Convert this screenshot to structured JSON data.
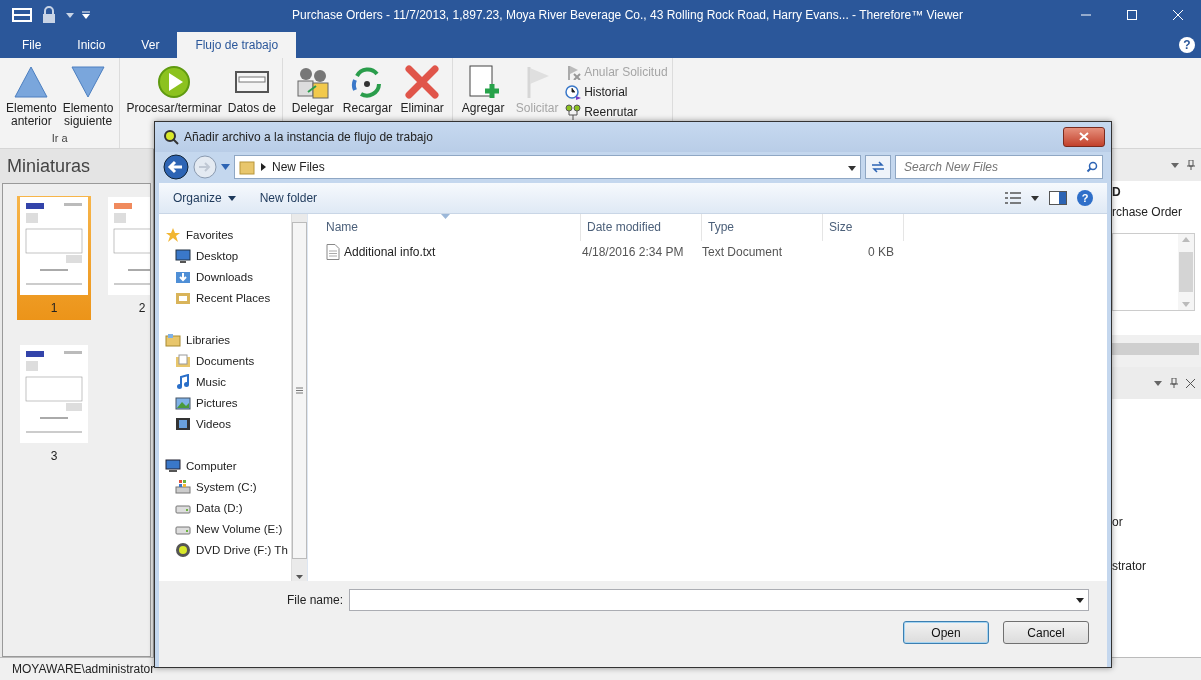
{
  "window": {
    "title": "Purchase Orders - 11/7/2013, 1,897.23, Moya River Beverage Co., 43 Rolling Rock Road, Harry Evans... - Therefore™ Viewer",
    "help": "?"
  },
  "menu_tabs": [
    {
      "label": "File",
      "selected": false
    },
    {
      "label": "Inicio",
      "selected": false
    },
    {
      "label": "Ver",
      "selected": false
    },
    {
      "label": "Flujo de trabajo",
      "selected": true
    }
  ],
  "ribbon": [
    {
      "label": "Ir a",
      "items": [
        {
          "kind": "large",
          "label": "Elemento\nanterior",
          "disabled": false
        },
        {
          "kind": "large",
          "label": "Elemento\nsiguiente",
          "disabled": false
        }
      ]
    },
    {
      "items": [
        {
          "kind": "large",
          "label": "Procesar/terminar",
          "disabled": false
        },
        {
          "kind": "large",
          "label": "Datos de",
          "disabled": false
        }
      ]
    },
    {
      "items": [
        {
          "kind": "large",
          "label": "Delegar",
          "disabled": false
        },
        {
          "kind": "large",
          "label": "Recargar",
          "disabled": false
        },
        {
          "kind": "large",
          "label": "Eliminar",
          "disabled": false
        }
      ]
    },
    {
      "items": [
        {
          "kind": "large",
          "label": "Agregar",
          "disabled": false
        },
        {
          "kind": "large",
          "label": "Solicitar",
          "disabled": true
        },
        {
          "kind": "small",
          "label": "Anular Solicitud",
          "disabled": true
        },
        {
          "kind": "small",
          "label": "Historial",
          "disabled": false
        },
        {
          "kind": "small",
          "label": "Reenrutar",
          "disabled": false
        }
      ]
    }
  ],
  "thumbnails": {
    "title": "Miniaturas",
    "pages": [
      {
        "label": "1",
        "selected": true
      },
      {
        "label": "2",
        "selected": false
      },
      {
        "label": "3",
        "selected": false
      }
    ]
  },
  "right_panel": {
    "lines": [
      {
        "kind": "heading",
        "text": "D"
      },
      {
        "kind": "text",
        "text": "rchase Order"
      }
    ],
    "lower_lines": [
      "or",
      "strator"
    ]
  },
  "status_bar": {
    "user": "MOYAWARE\\administrator"
  },
  "dialog": {
    "title": "Añadir archivo a la instancia de flujo de trabajo",
    "address": "New Files",
    "search_placeholder": "Search New Files",
    "help": "?",
    "toolbar": [
      "Organize",
      "New folder"
    ],
    "nav": [
      {
        "label": "Favorites",
        "children": [
          {
            "label": "Desktop"
          },
          {
            "label": "Downloads"
          },
          {
            "label": "Recent Places"
          }
        ]
      },
      {
        "label": "Libraries",
        "children": [
          {
            "label": "Documents"
          },
          {
            "label": "Music"
          },
          {
            "label": "Pictures"
          },
          {
            "label": "Videos"
          }
        ]
      },
      {
        "label": "Computer",
        "children": [
          {
            "label": "System (C:)"
          },
          {
            "label": "Data (D:)"
          },
          {
            "label": "New Volume (E:)"
          },
          {
            "label": "DVD Drive (F:) Th"
          }
        ]
      }
    ],
    "columns": [
      "Name",
      "Date modified",
      "Type",
      "Size"
    ],
    "files": [
      {
        "name": "Additional info.txt",
        "date": "4/18/2016 2:34 PM",
        "type": "Text Document",
        "size": "0 KB",
        "selected": false
      }
    ],
    "file_name_label": "File name:",
    "buttons": [
      {
        "label": "Open",
        "default": true
      },
      {
        "label": "Cancel",
        "default": false
      }
    ]
  }
}
